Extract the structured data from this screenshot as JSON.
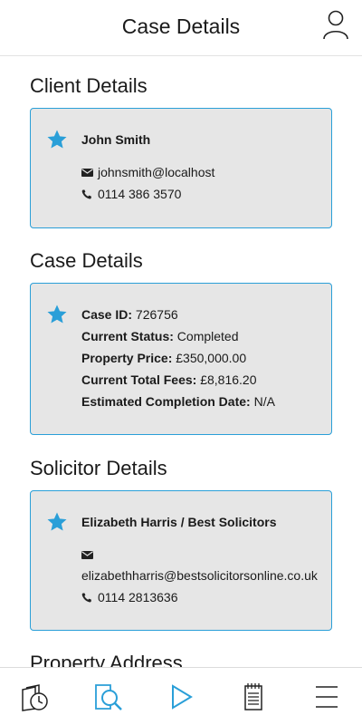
{
  "header": {
    "title": "Case Details",
    "profile_icon": "user-outline-icon"
  },
  "client": {
    "section_title": "Client Details",
    "name": "John Smith",
    "email": "johnsmith@localhost",
    "phone": "0114 386 3570"
  },
  "case": {
    "section_title": "Case Details",
    "rows": [
      {
        "label": "Case ID:",
        "value": " 726756"
      },
      {
        "label": "Current Status:",
        "value": " Completed"
      },
      {
        "label": "Property Price:",
        "value": " £350,000.00"
      },
      {
        "label": "Current Total Fees:",
        "value": " £8,816.20"
      },
      {
        "label": "Estimated Completion Date:",
        "value": " N/A"
      }
    ]
  },
  "solicitor": {
    "section_title": "Solicitor Details",
    "name": "Elizabeth Harris / Best Solicitors",
    "email": "elizabethharris@bestsolicitorsonline.co.uk",
    "phone": "0114 2813636"
  },
  "property": {
    "section_title": "Property Address"
  },
  "tabs": [
    "documents-clock-icon",
    "document-search-icon",
    "play-icon",
    "notepad-icon",
    "menu-icon"
  ],
  "colors": {
    "accent": "#2a9fd8",
    "card_bg": "#e6e6e6",
    "text": "#1a1a1a"
  }
}
